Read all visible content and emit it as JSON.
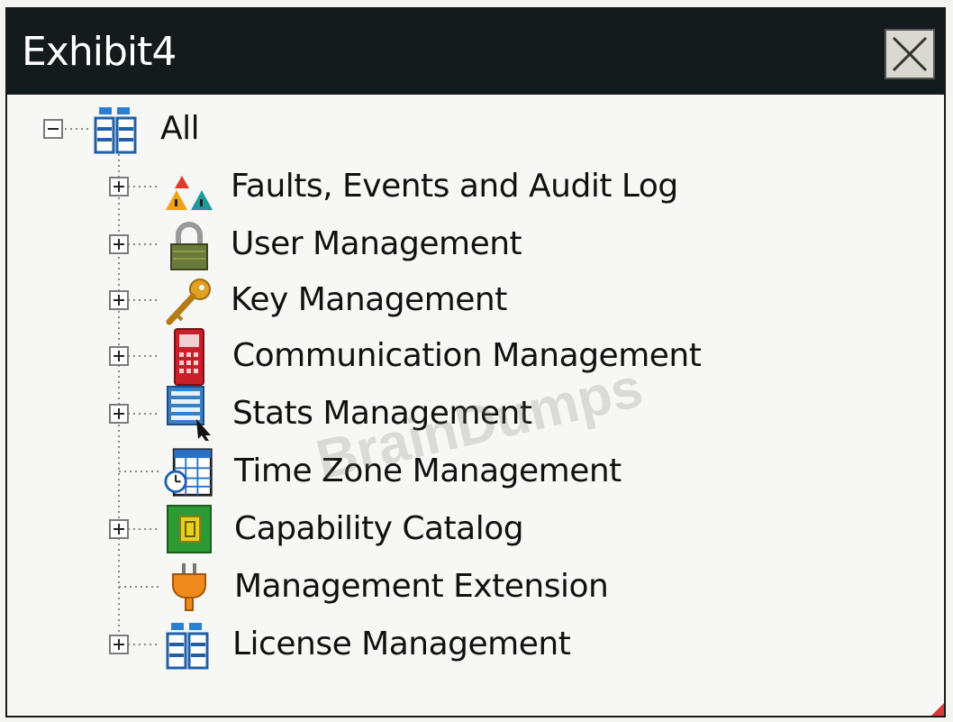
{
  "window": {
    "title": "Exhibit4",
    "close_icon": "close-icon"
  },
  "tree": {
    "root": {
      "label": "All",
      "icon": "server-icon",
      "expanded": true
    },
    "items": [
      {
        "label": "Faults, Events and Audit Log",
        "icon": "warning-triangles-icon",
        "expandable": true
      },
      {
        "label": "User Management",
        "icon": "lock-icon",
        "expandable": true
      },
      {
        "label": "Key Management",
        "icon": "key-icon",
        "expandable": true
      },
      {
        "label": "Communication Management",
        "icon": "phone-icon",
        "expandable": true
      },
      {
        "label": "Stats Management",
        "icon": "stats-icon",
        "expandable": true
      },
      {
        "label": "Time Zone Management",
        "icon": "calendar-clock-icon",
        "expandable": false
      },
      {
        "label": "Capability Catalog",
        "icon": "catalog-icon",
        "expandable": true
      },
      {
        "label": "Management Extension",
        "icon": "plug-icon",
        "expandable": false
      },
      {
        "label": "License Management",
        "icon": "server-icon",
        "expandable": true
      }
    ]
  },
  "watermark": "BrainDumps",
  "colors": {
    "titlebar": "#151a1c",
    "title_text": "#ffffff",
    "background": "#f7f7f5"
  }
}
